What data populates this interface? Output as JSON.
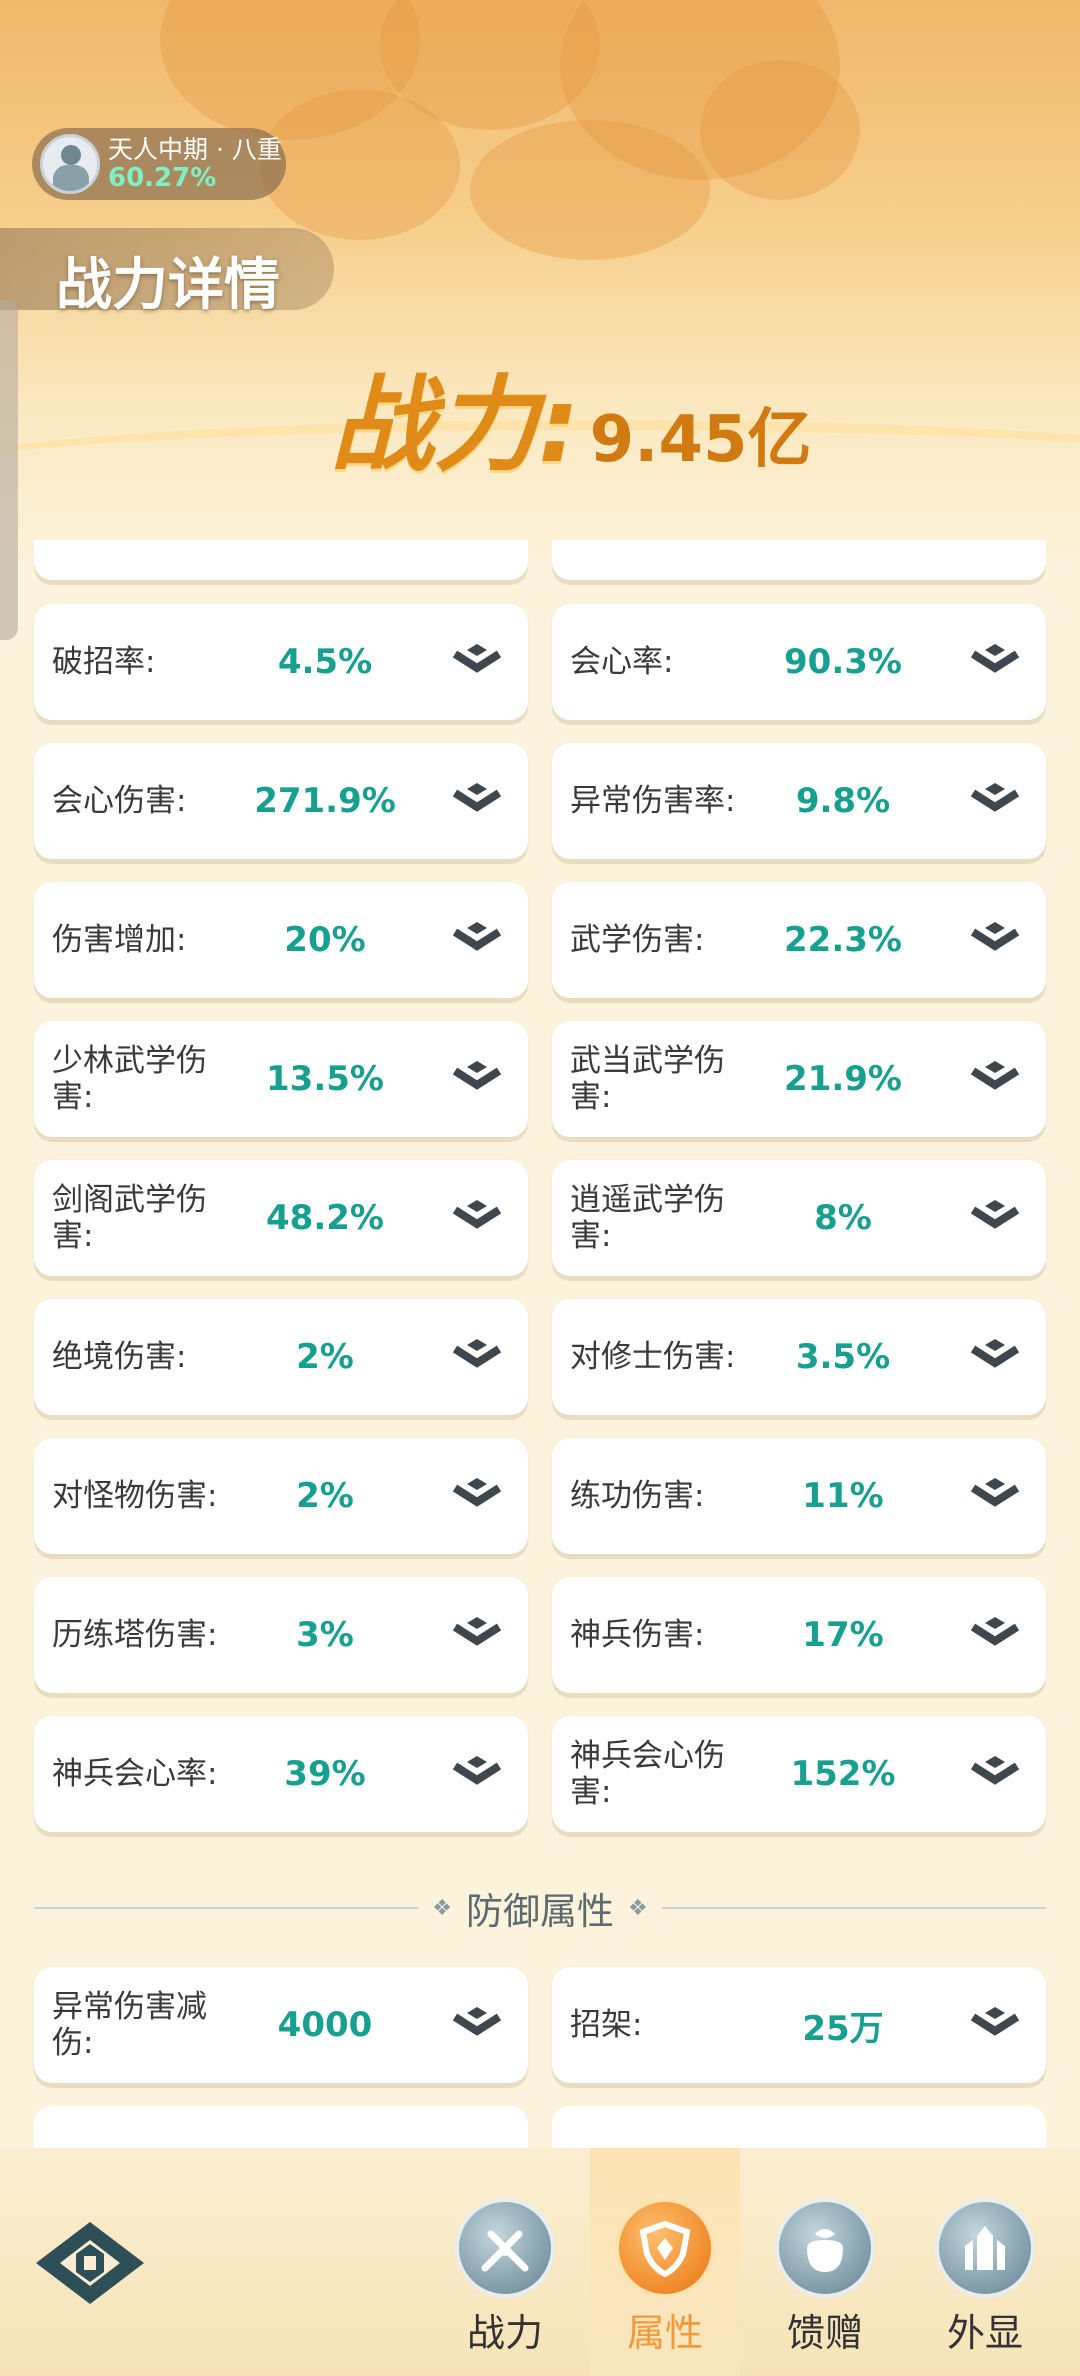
{
  "rank": {
    "name": "天人中期 · 八重",
    "percent": "60.27%"
  },
  "page_title": "战力详情",
  "power": {
    "label": "战力:",
    "value": "9.45亿"
  },
  "stats": [
    {
      "label": "破招率:",
      "value": "4.5%"
    },
    {
      "label": "会心率:",
      "value": "90.3%"
    },
    {
      "label": "会心伤害:",
      "value": "271.9%"
    },
    {
      "label": "异常伤害率:",
      "value": "9.8%"
    },
    {
      "label": "伤害增加:",
      "value": "20%"
    },
    {
      "label": "武学伤害:",
      "value": "22.3%"
    },
    {
      "label": "少林武学伤害:",
      "value": "13.5%"
    },
    {
      "label": "武当武学伤害:",
      "value": "21.9%"
    },
    {
      "label": "剑阁武学伤害:",
      "value": "48.2%"
    },
    {
      "label": "逍遥武学伤害:",
      "value": "8%"
    },
    {
      "label": "绝境伤害:",
      "value": "2%"
    },
    {
      "label": "对修士伤害:",
      "value": "3.5%"
    },
    {
      "label": "对怪物伤害:",
      "value": "2%"
    },
    {
      "label": "练功伤害:",
      "value": "11%"
    },
    {
      "label": "历练塔伤害:",
      "value": "3%"
    },
    {
      "label": "神兵伤害:",
      "value": "17%"
    },
    {
      "label": "神兵会心率:",
      "value": "39%"
    },
    {
      "label": "神兵会心伤害:",
      "value": "152%"
    }
  ],
  "defense_section": {
    "title": "防御属性"
  },
  "defense_stats": [
    {
      "label": "异常伤害减伤:",
      "value": "4000"
    },
    {
      "label": "招架:",
      "value": "25万"
    }
  ],
  "nav": {
    "items": [
      {
        "label": "战力",
        "icon": "sword-icon"
      },
      {
        "label": "属性",
        "icon": "shield-icon",
        "active": true
      },
      {
        "label": "馈赠",
        "icon": "gift-bag-icon"
      },
      {
        "label": "外显",
        "icon": "castle-icon"
      }
    ]
  },
  "colors": {
    "value": "#17a08f",
    "power": "#e08a18",
    "active_nav": "#f29a3a"
  }
}
